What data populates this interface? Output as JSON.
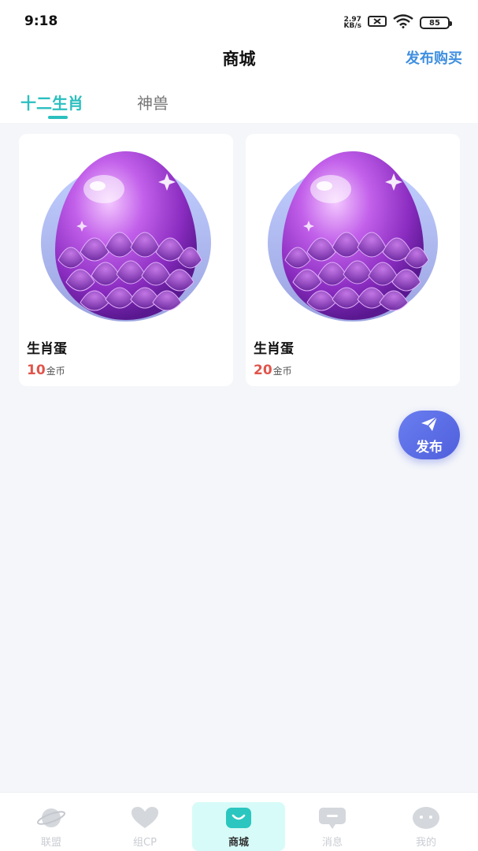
{
  "status": {
    "time": "9:18",
    "net_speed_value": "2.97",
    "net_speed_unit": "KB/s",
    "battery": "85"
  },
  "header": {
    "title": "商城",
    "publish_buy_label": "发布购买"
  },
  "tabs": [
    {
      "label": "十二生肖",
      "active": true
    },
    {
      "label": "神兽",
      "active": false
    }
  ],
  "products": [
    {
      "name": "生肖蛋",
      "price": "10",
      "currency": "金币"
    },
    {
      "name": "生肖蛋",
      "price": "20",
      "currency": "金币"
    }
  ],
  "fab": {
    "label": "发布",
    "icon": "paper-plane-icon"
  },
  "bottom_nav": [
    {
      "label": "联盟",
      "icon": "planet-icon",
      "active": false
    },
    {
      "label": "组CP",
      "icon": "heart-icon",
      "active": false
    },
    {
      "label": "商城",
      "icon": "shopping-bag-icon",
      "active": true
    },
    {
      "label": "消息",
      "icon": "message-icon",
      "active": false
    },
    {
      "label": "我的",
      "icon": "face-icon",
      "active": false
    }
  ],
  "colors": {
    "accent_teal": "#2bbfbf",
    "link_blue": "#3f8fe0",
    "price_red": "#e0554b",
    "fab_blue": "#5a6ae6"
  }
}
